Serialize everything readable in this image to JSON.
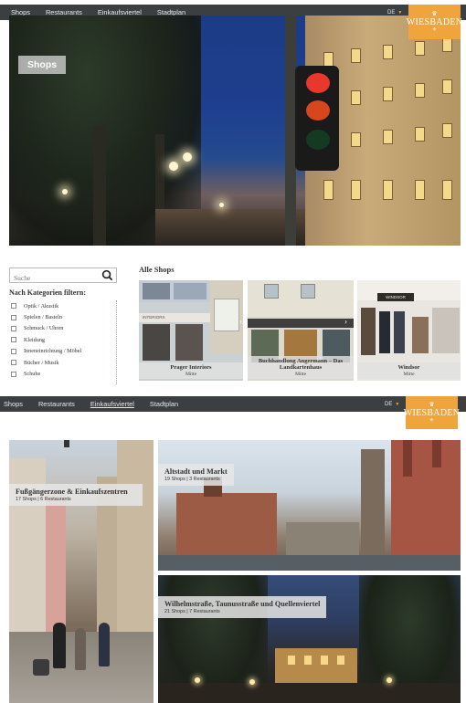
{
  "screen1": {
    "nav": [
      {
        "label": "Shops",
        "active": true
      },
      {
        "label": "Restaurants",
        "active": false
      },
      {
        "label": "Einkaufsviertel",
        "active": false
      },
      {
        "label": "Stadtplan",
        "active": false
      }
    ],
    "lang": "DE",
    "logo": "WIESBADEN",
    "hero_title": "Shops",
    "search_placeholder": "Suche",
    "filter_title": "Nach Kategorien filtern:",
    "categories": [
      "Optik / Akustik",
      "Spielen / Basteln",
      "Schmuck / Uhren",
      "Kleidung",
      "Inneneinrichtung / Möbel",
      "Bücher / Musik",
      "Schuhe"
    ],
    "shops_title": "Alle Shops",
    "shops": [
      {
        "name": "Prager Interiors",
        "location": "Mitte",
        "sign": "INTERIORS"
      },
      {
        "name": "Buchhandlung Angermann – Das Landkartenhaus",
        "location": "Mitte"
      },
      {
        "name": "Windsor",
        "location": "Mitte",
        "sign": "WINDSOR"
      }
    ]
  },
  "screen2": {
    "nav": [
      {
        "label": "Shops",
        "active": false
      },
      {
        "label": "Restaurants",
        "active": false
      },
      {
        "label": "Einkaufsviertel",
        "active": true
      },
      {
        "label": "Stadtplan",
        "active": false
      }
    ],
    "lang": "DE",
    "logo": "WIESBADEN",
    "districts": [
      {
        "name": "Fußgängerzone & Einkaufszentren",
        "info": "17 Shops | 6 Restaurants"
      },
      {
        "name": "Altstadt und Markt",
        "info": "19 Shops | 3 Restaurants"
      },
      {
        "name": "Wilhelmstraße, Taunusstraße und Quellenviertel",
        "info": "21 Shops | 7 Restaurants"
      }
    ]
  },
  "colors": {
    "nav_bg": "#3b3f42",
    "accent": "#f0a43c"
  }
}
